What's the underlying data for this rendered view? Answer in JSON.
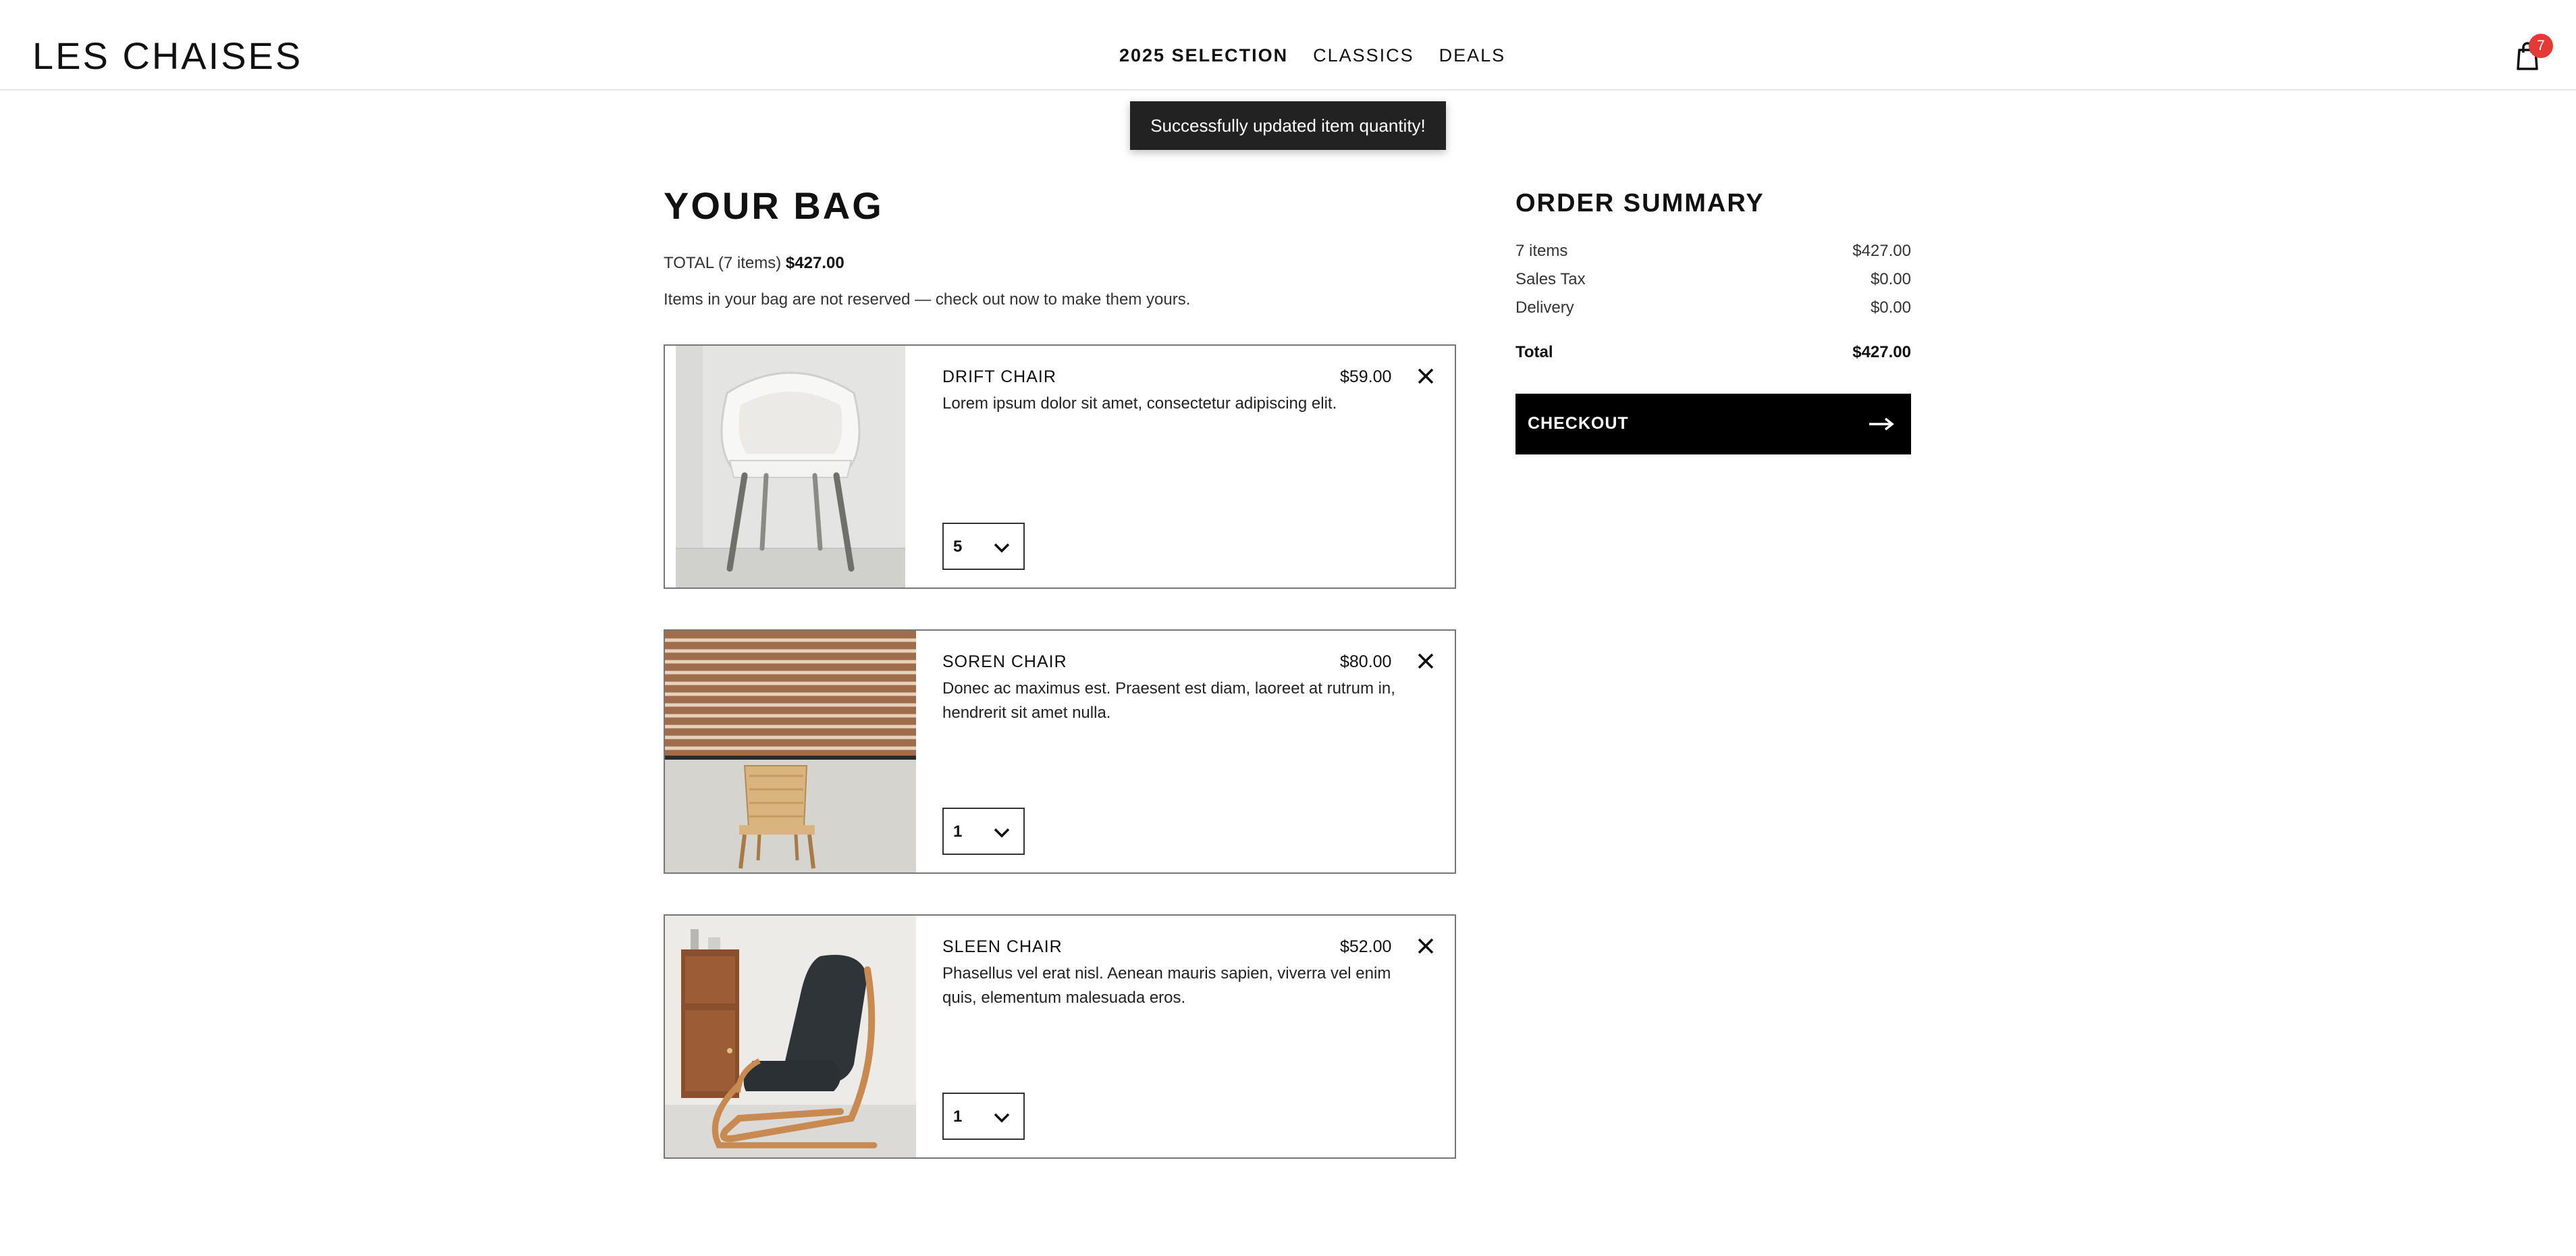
{
  "brand": {
    "logo": "LES CHAISES"
  },
  "nav": {
    "items": [
      {
        "label": "2025 SELECTION",
        "active": true
      },
      {
        "label": "CLASSICS",
        "active": false
      },
      {
        "label": "DEALS",
        "active": false
      }
    ]
  },
  "cart": {
    "count": "7",
    "icon": "shopping-bag-icon",
    "badge_color": "#e53935"
  },
  "toast": {
    "message": "Successfully updated item quantity!"
  },
  "bag": {
    "title": "YOUR BAG",
    "total_prefix": "TOTAL (7 items)",
    "total_amount": "$427.00",
    "note": "Items in your bag are not reserved — check out now to make them yours.",
    "items": [
      {
        "name": "DRIFT CHAIR",
        "price": "$59.00",
        "description": "Lorem ipsum dolor sit amet, consectetur adipiscing elit.",
        "quantity": "5"
      },
      {
        "name": "SOREN CHAIR",
        "price": "$80.00",
        "description": "Donec ac maximus est. Praesent est diam, laoreet at rutrum in, hendrerit sit amet nulla.",
        "quantity": "1"
      },
      {
        "name": "SLEEN CHAIR",
        "price": "$52.00",
        "description": "Phasellus vel erat nisl. Aenean mauris sapien, viverra vel enim quis, elementum malesuada eros.",
        "quantity": "1"
      }
    ]
  },
  "summary": {
    "title": "ORDER SUMMARY",
    "rows": [
      {
        "label": "7 items",
        "amount": "$427.00"
      },
      {
        "label": "Sales Tax",
        "amount": "$0.00"
      },
      {
        "label": "Delivery",
        "amount": "$0.00"
      }
    ],
    "total_label": "Total",
    "total_amount": "$427.00",
    "checkout_label": "CHECKOUT"
  },
  "colors": {
    "checkout_bg": "#000000",
    "toast_bg": "#222222",
    "accent": "#e53935"
  }
}
